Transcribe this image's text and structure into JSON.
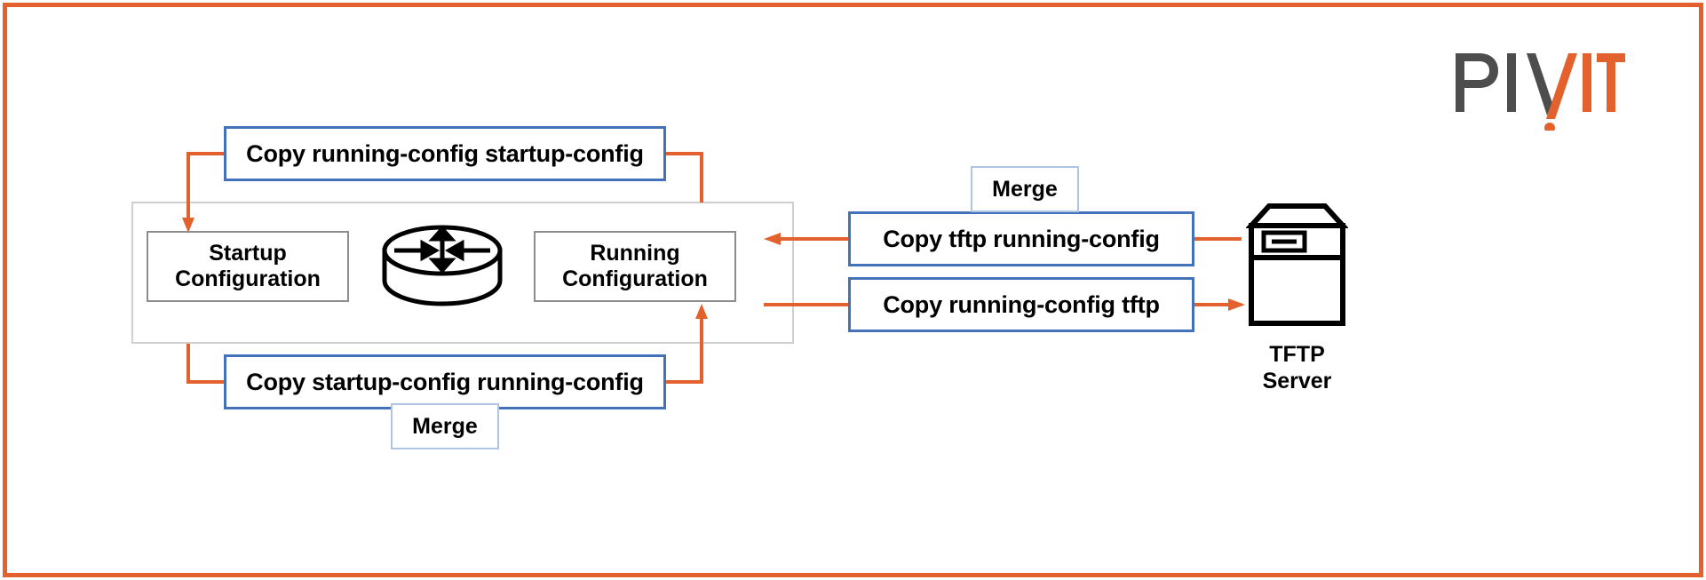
{
  "page": {
    "title": "Cisco configuration copy operations diagram",
    "frame_color": "#E2612C",
    "background": "#ffffff"
  },
  "logo": {
    "name": "PIVIT",
    "part_dark": "PIV",
    "part_accent": "IT",
    "dark_color": "#4D4D4D",
    "accent_color": "#E2612C"
  },
  "device": {
    "label": "",
    "border_color": "#CFCFCF",
    "startup": {
      "line1": "Startup",
      "line2": "Configuration"
    },
    "running": {
      "line1": "Running",
      "line2": "Configuration"
    },
    "icon": "router-icon"
  },
  "commands": {
    "copy_running_to_startup": "Copy running-config startup-config",
    "copy_startup_to_running": "Copy startup-config running-config",
    "copy_tftp_to_running": "Copy tftp running-config",
    "copy_running_to_tftp": "Copy running-config tftp",
    "border_color": "#4472B8"
  },
  "merge_labels": {
    "bottom": "Merge",
    "right": "Merge",
    "border_color": "#AFC3E2"
  },
  "server": {
    "line1": "TFTP",
    "line2": "Server",
    "icon": "tftp-server-icon"
  },
  "connectors": {
    "color": "#E2612C",
    "items": [
      {
        "name": "running-to-startup-arrow",
        "direction": "down-into-startup-configuration"
      },
      {
        "name": "running-config-tap",
        "direction": "up-from-running-configuration"
      },
      {
        "name": "startup-to-running-arrow",
        "direction": "up-into-running-configuration"
      },
      {
        "name": "startup-config-tap",
        "direction": "down-from-startup-configuration"
      },
      {
        "name": "tftp-to-device-arrow",
        "direction": "left-into-device"
      },
      {
        "name": "device-to-tftp-arrow",
        "direction": "right-into-tftp-server"
      }
    ]
  }
}
